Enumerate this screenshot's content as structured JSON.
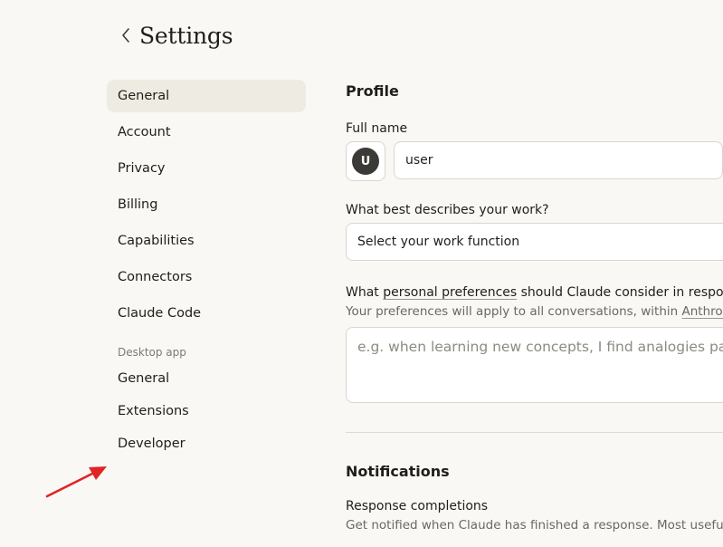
{
  "header": {
    "back_icon": "chevron-left-icon",
    "title": "Settings"
  },
  "sidebar": {
    "items": [
      {
        "label": "General",
        "active": true
      },
      {
        "label": "Account"
      },
      {
        "label": "Privacy"
      },
      {
        "label": "Billing"
      },
      {
        "label": "Capabilities"
      },
      {
        "label": "Connectors"
      },
      {
        "label": "Claude Code"
      }
    ],
    "desktop_section_label": "Desktop app",
    "desktop_items": [
      {
        "label": "General"
      },
      {
        "label": "Extensions"
      },
      {
        "label": "Developer"
      }
    ]
  },
  "profile": {
    "title": "Profile",
    "full_name_label": "Full name",
    "avatar_initial": "U",
    "full_name_value": "user",
    "work_label": "What best describes your work?",
    "work_select_value": "Select your work function",
    "pref_question_prefix": "What ",
    "pref_question_link": "personal preferences",
    "pref_question_suffix": " should Claude consider in response",
    "pref_sub_prefix": "Your preferences will apply to all conversations, within ",
    "pref_sub_link": "Anthropi",
    "pref_placeholder": "e.g. when learning new concepts, I find analogies partic"
  },
  "notifications": {
    "title": "Notifications",
    "response_completions_label": "Response completions",
    "response_completions_desc": "Get notified when Claude has finished a response. Most useful"
  },
  "annotation": {
    "arrow_color": "#e02424",
    "arrow_icon": "red-arrow-icon"
  }
}
